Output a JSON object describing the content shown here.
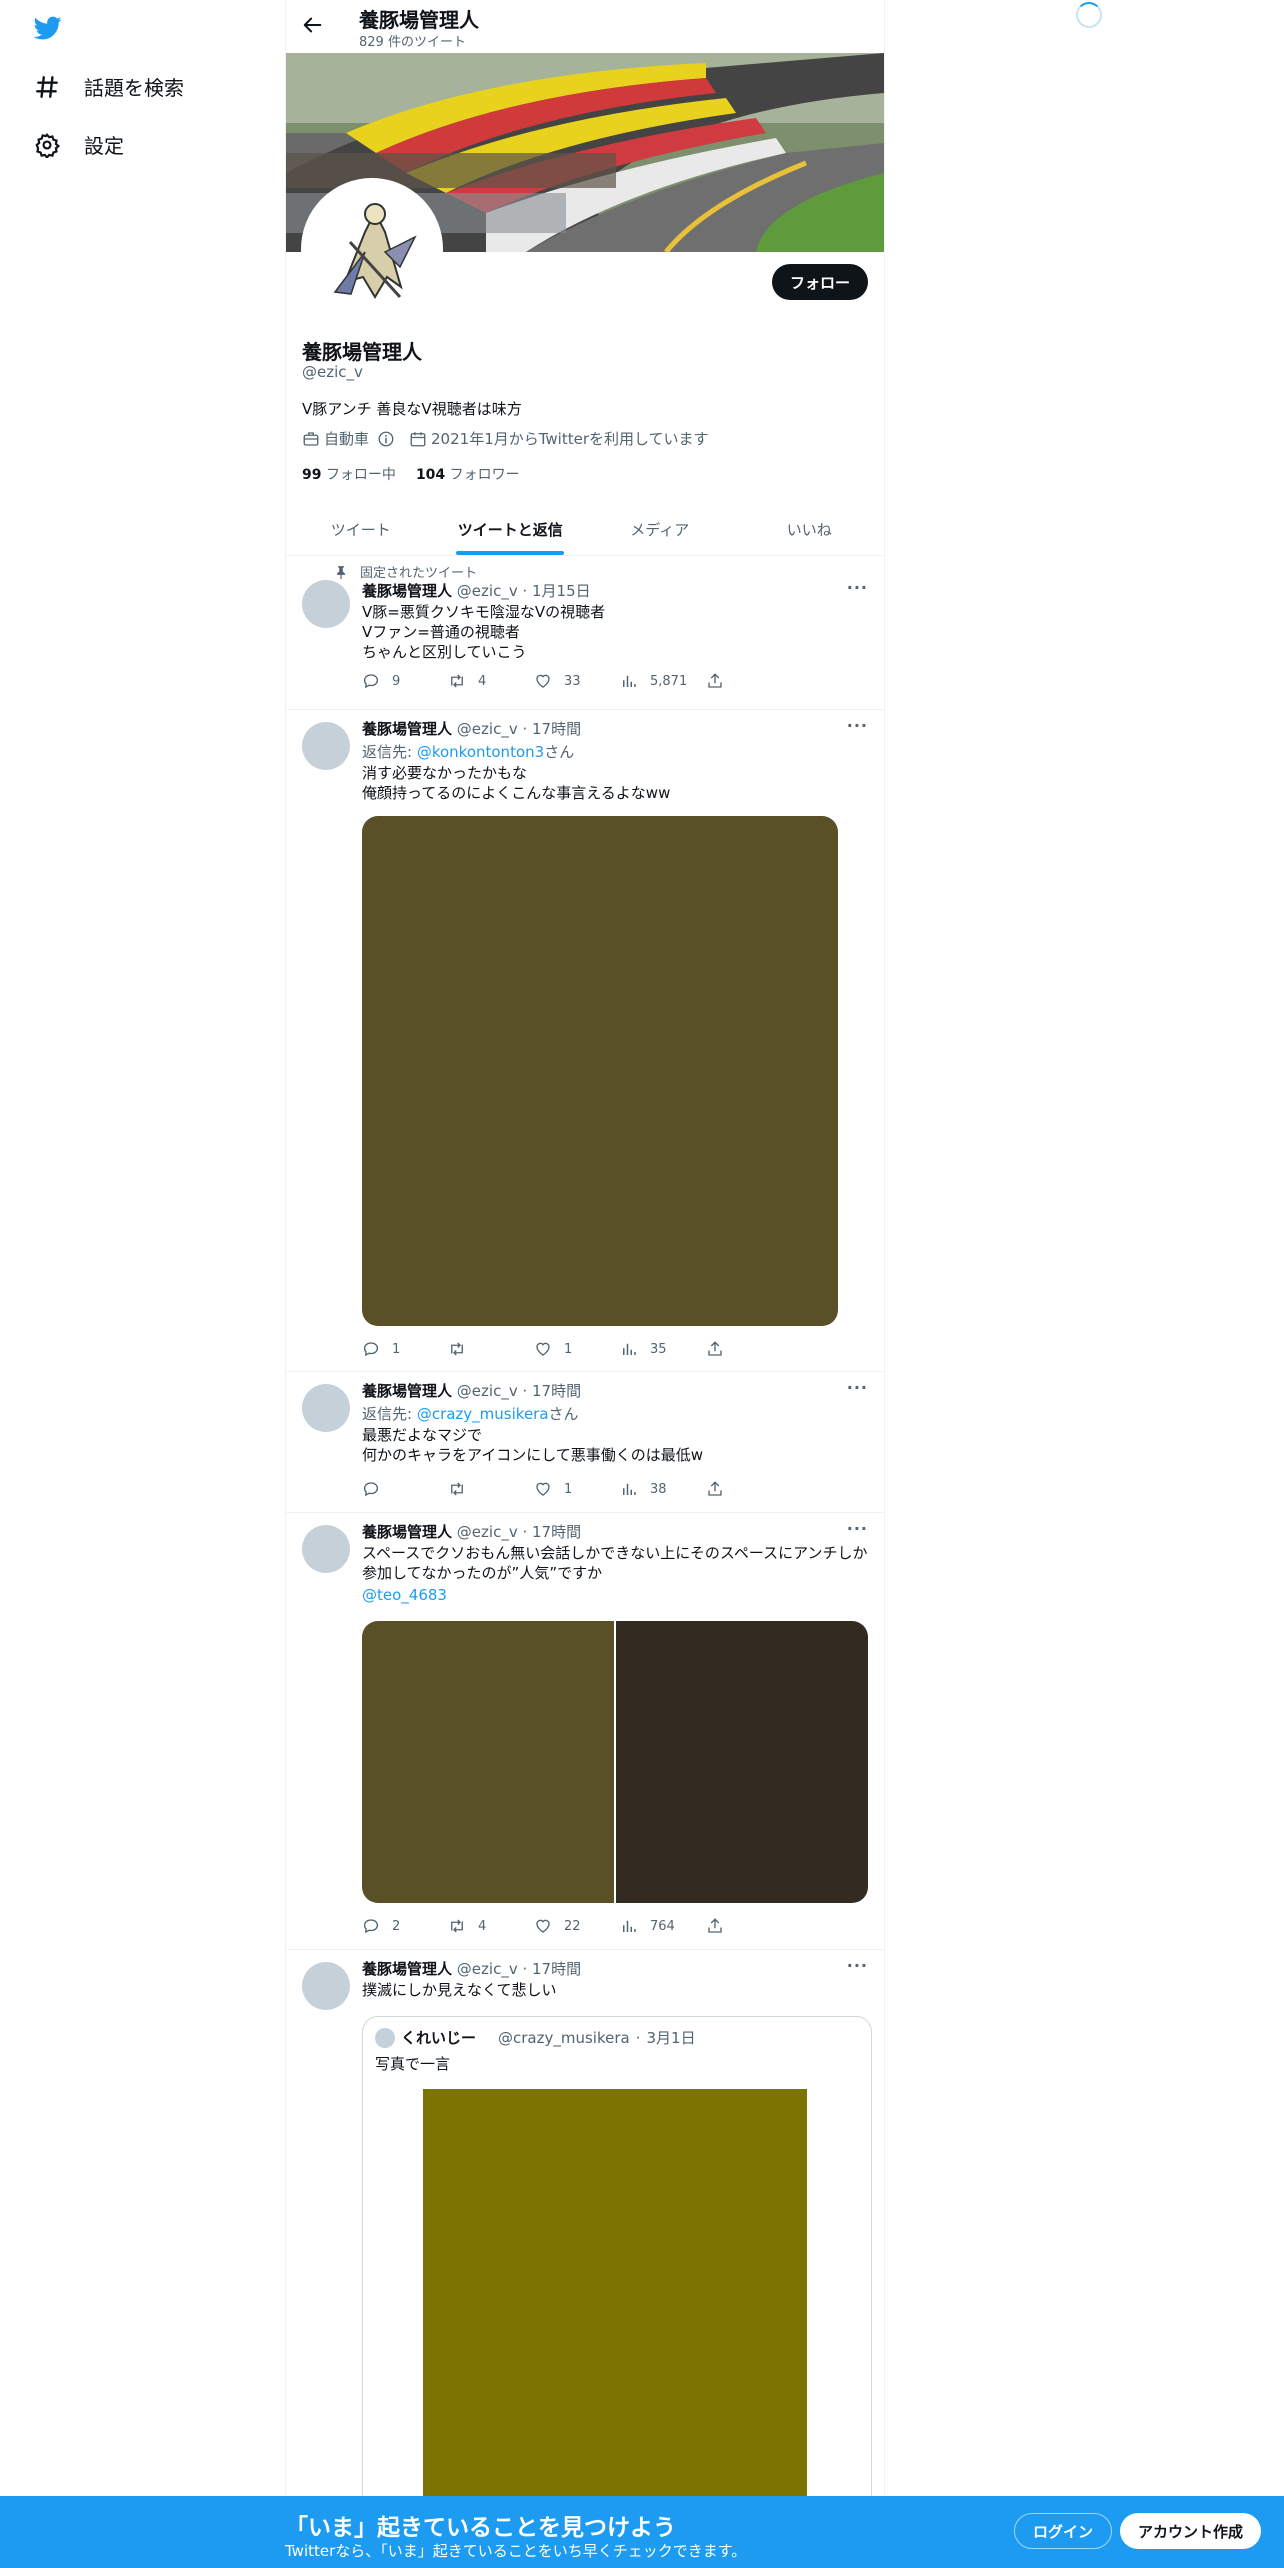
{
  "nav": {
    "logo": "twitter-bird-icon",
    "items": [
      {
        "label": "話題を検索",
        "icon": "hashtag-icon"
      },
      {
        "label": "設定",
        "icon": "gear-icon"
      }
    ]
  },
  "header": {
    "title": "養豚場管理人",
    "subtitle": "829 件のツイート"
  },
  "profile": {
    "name": "養豚場管理人",
    "handle": "@ezic_v",
    "bio": "V豚アンチ 善良なV視聴者は味方",
    "category": "自動車",
    "joined": "2021年1月からTwitterを利用しています",
    "following_count": "99",
    "following_label": "フォロー中",
    "followers_count": "104",
    "followers_label": "フォロワー",
    "follow_button": "フォロー"
  },
  "tabs": [
    {
      "label": "ツイート",
      "active": false
    },
    {
      "label": "ツイートと返信",
      "active": true
    },
    {
      "label": "メディア",
      "active": false
    },
    {
      "label": "いいね",
      "active": false
    }
  ],
  "tweets": [
    {
      "pinned_label": "固定されたツイート",
      "name": "養豚場管理人",
      "handle": "@ezic_v",
      "time": "1月15日",
      "text": "V豚=悪質クソキモ陰湿なVの視聴者\nVファン=普通の視聴者\nちゃんと区別していこう",
      "replies": "9",
      "retweets": "4",
      "likes": "33",
      "views": "5,871"
    },
    {
      "name": "養豚場管理人",
      "handle": "@ezic_v",
      "time": "17時間",
      "reply_prefix": "返信先: ",
      "reply_to": "@konkontonton3",
      "reply_suffix": "さん",
      "text": "消す必要なかったかもな\n俺顔持ってるのによくこんな事言えるよなww",
      "media_color": "#5a5028",
      "replies": "1",
      "retweets": "",
      "likes": "1",
      "views": "35"
    },
    {
      "name": "養豚場管理人",
      "handle": "@ezic_v",
      "time": "17時間",
      "reply_prefix": "返信先: ",
      "reply_to": "@crazy_musikera",
      "reply_suffix": "さん",
      "text": "最悪だよなマジで\n何かのキャラをアイコンにして悪事働くのは最低w",
      "replies": "",
      "retweets": "",
      "likes": "1",
      "views": "38"
    },
    {
      "name": "養豚場管理人",
      "handle": "@ezic_v",
      "time": "17時間",
      "text": "スペースでクソおもん無い会話しかできない上にそのスペースにアンチしか参加してなかったのが”人気”ですか",
      "link": "@teo_4683",
      "media_colors": [
        "#5a5028",
        "#332b22"
      ],
      "replies": "2",
      "retweets": "4",
      "likes": "22",
      "views": "764"
    },
    {
      "name": "養豚場管理人",
      "handle": "@ezic_v",
      "time": "17時間",
      "text": "撲滅にしか見えなくて悲しい",
      "quote": {
        "name": "くれいじー",
        "handle": "@crazy_musikera",
        "time": "3月1日",
        "text": "写真で一言",
        "media_color": "#7c7400"
      }
    }
  ],
  "bottom_bar": {
    "title": "「いま」起きていることを見つけよう",
    "subtitle": "Twitterなら、「いま」起きていることをいち早くチェックできます。",
    "login": "ログイン",
    "signup": "アカウント作成"
  },
  "colors": {
    "accent": "#1d9bf0",
    "text": "#0f1419",
    "secondary": "#536471"
  }
}
